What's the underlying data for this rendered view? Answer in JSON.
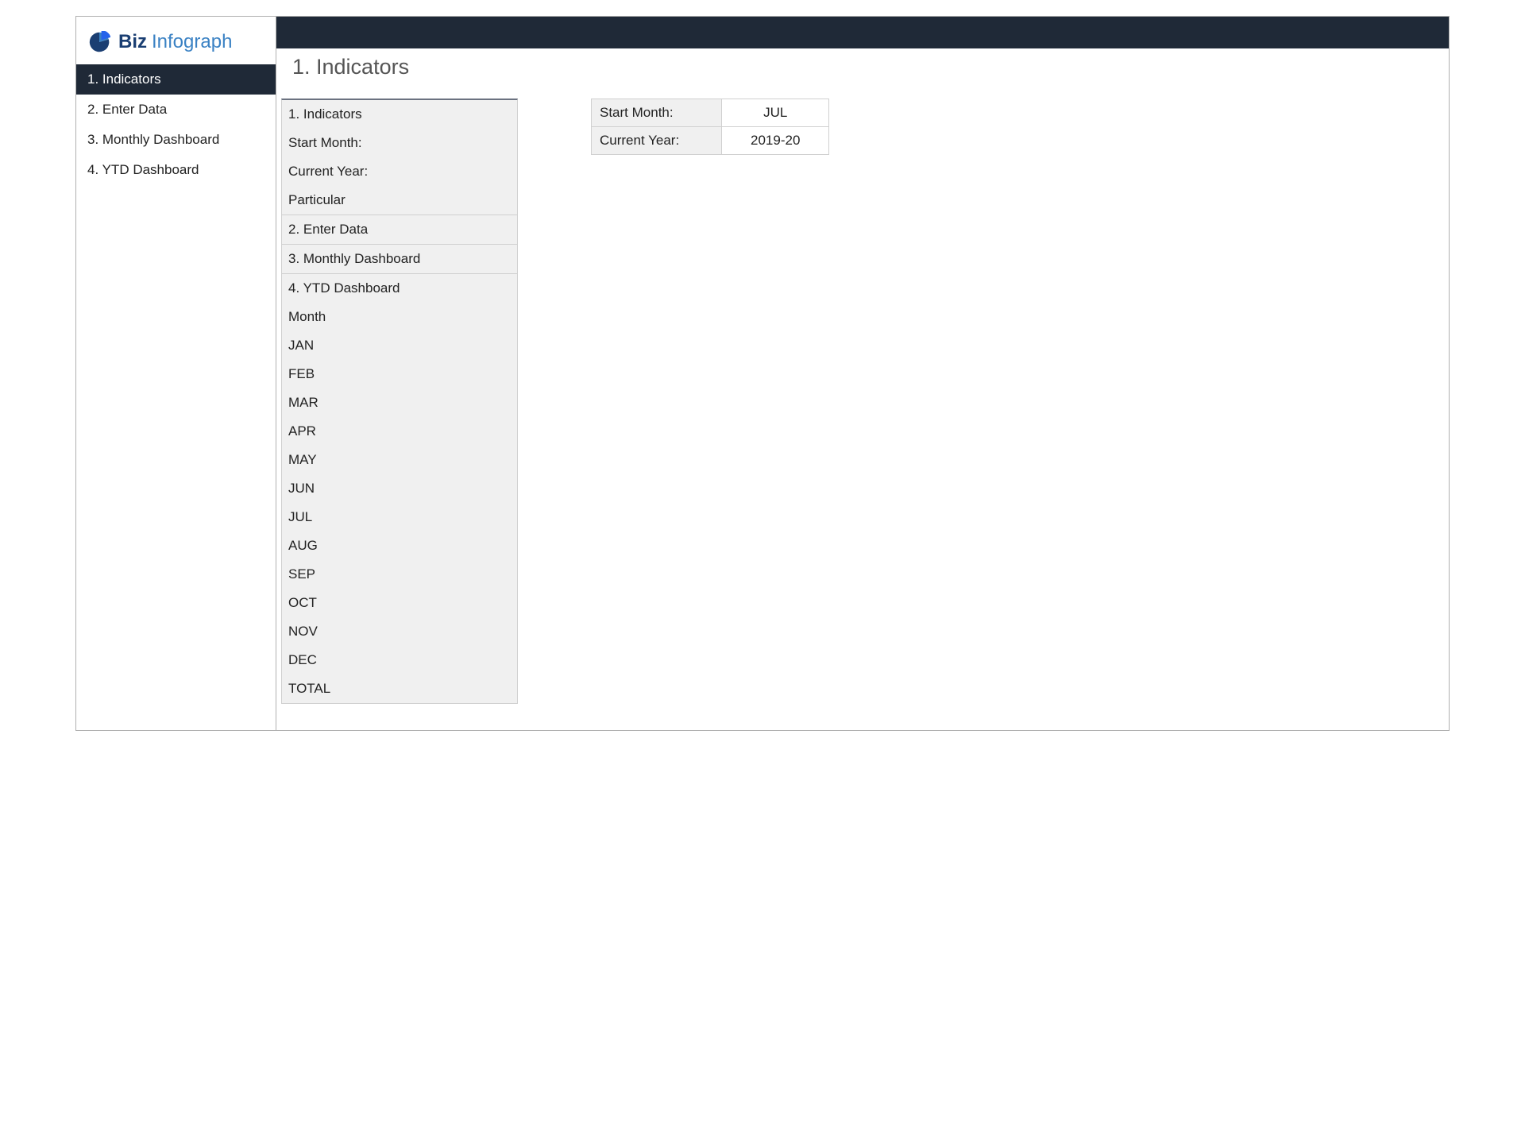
{
  "brand": {
    "biz_text": "Biz",
    "infograph_text": "Infograph"
  },
  "sidebar": {
    "items": [
      {
        "label": "1. Indicators",
        "active": true
      },
      {
        "label": "2. Enter Data",
        "active": false
      },
      {
        "label": "3. Monthly Dashboard",
        "active": false
      },
      {
        "label": "4. YTD Dashboard",
        "active": false
      }
    ]
  },
  "page": {
    "title": "1. Indicators"
  },
  "indicators_list": [
    {
      "label": "1. Indicators",
      "bordered": false
    },
    {
      "label": "Start Month:",
      "bordered": false
    },
    {
      "label": "Current Year:",
      "bordered": false
    },
    {
      "label": "Particular",
      "bordered": true
    },
    {
      "label": "2. Enter Data",
      "bordered": true
    },
    {
      "label": "3. Monthly Dashboard",
      "bordered": true
    },
    {
      "label": "4. YTD Dashboard",
      "bordered": false
    },
    {
      "label": "Month",
      "bordered": false
    },
    {
      "label": "JAN",
      "bordered": false
    },
    {
      "label": "FEB",
      "bordered": false
    },
    {
      "label": "MAR",
      "bordered": false
    },
    {
      "label": "APR",
      "bordered": false
    },
    {
      "label": "MAY",
      "bordered": false
    },
    {
      "label": "JUN",
      "bordered": false
    },
    {
      "label": "JUL",
      "bordered": false
    },
    {
      "label": "AUG",
      "bordered": false
    },
    {
      "label": "SEP",
      "bordered": false
    },
    {
      "label": "OCT",
      "bordered": false
    },
    {
      "label": "NOV",
      "bordered": false
    },
    {
      "label": "DEC",
      "bordered": false
    },
    {
      "label": "TOTAL",
      "bordered": false
    }
  ],
  "info_table": [
    {
      "label": "Start Month:",
      "value": "JUL"
    },
    {
      "label": "Current Year:",
      "value": "2019-20"
    }
  ]
}
